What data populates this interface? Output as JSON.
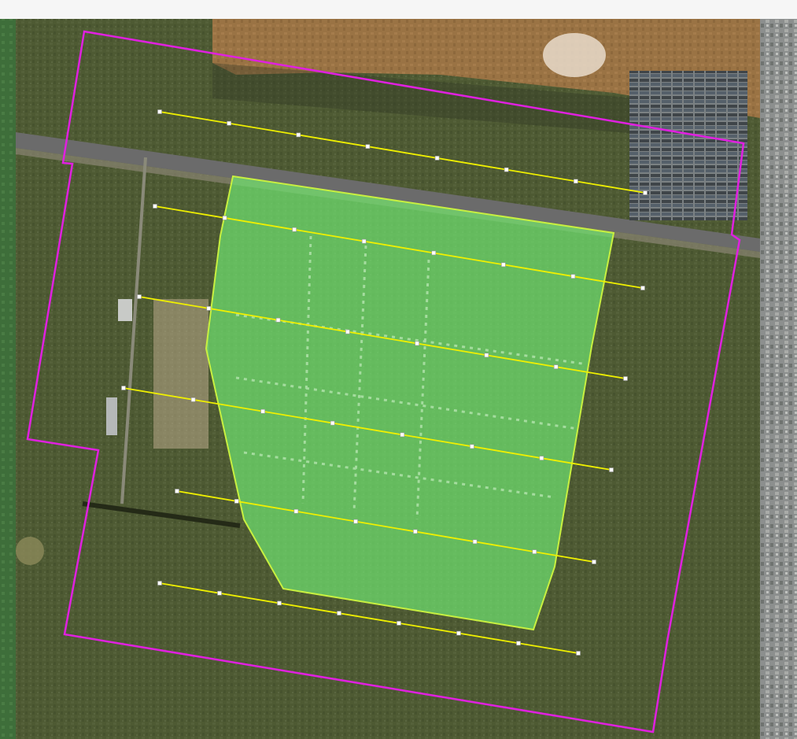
{
  "map": {
    "type": "satellite",
    "colors": {
      "site_boundary": "#e020e0",
      "development_area_fill": "#6fe06f",
      "development_area_stroke": "#c8f040",
      "transect_line": "#f0f000",
      "transect_node": "#ffffff",
      "top_margin": "#f6f6f6",
      "grass": "#4e5a33",
      "dry_field": "#9a7344",
      "road": "#6b6b6b",
      "urban_tiles": "#8c8f8e"
    },
    "layers": {
      "site_boundary": {
        "count": 1
      },
      "development_area": {
        "count": 1
      },
      "transect_lines": {
        "count": 6,
        "nodes_per_line": 8
      }
    }
  }
}
